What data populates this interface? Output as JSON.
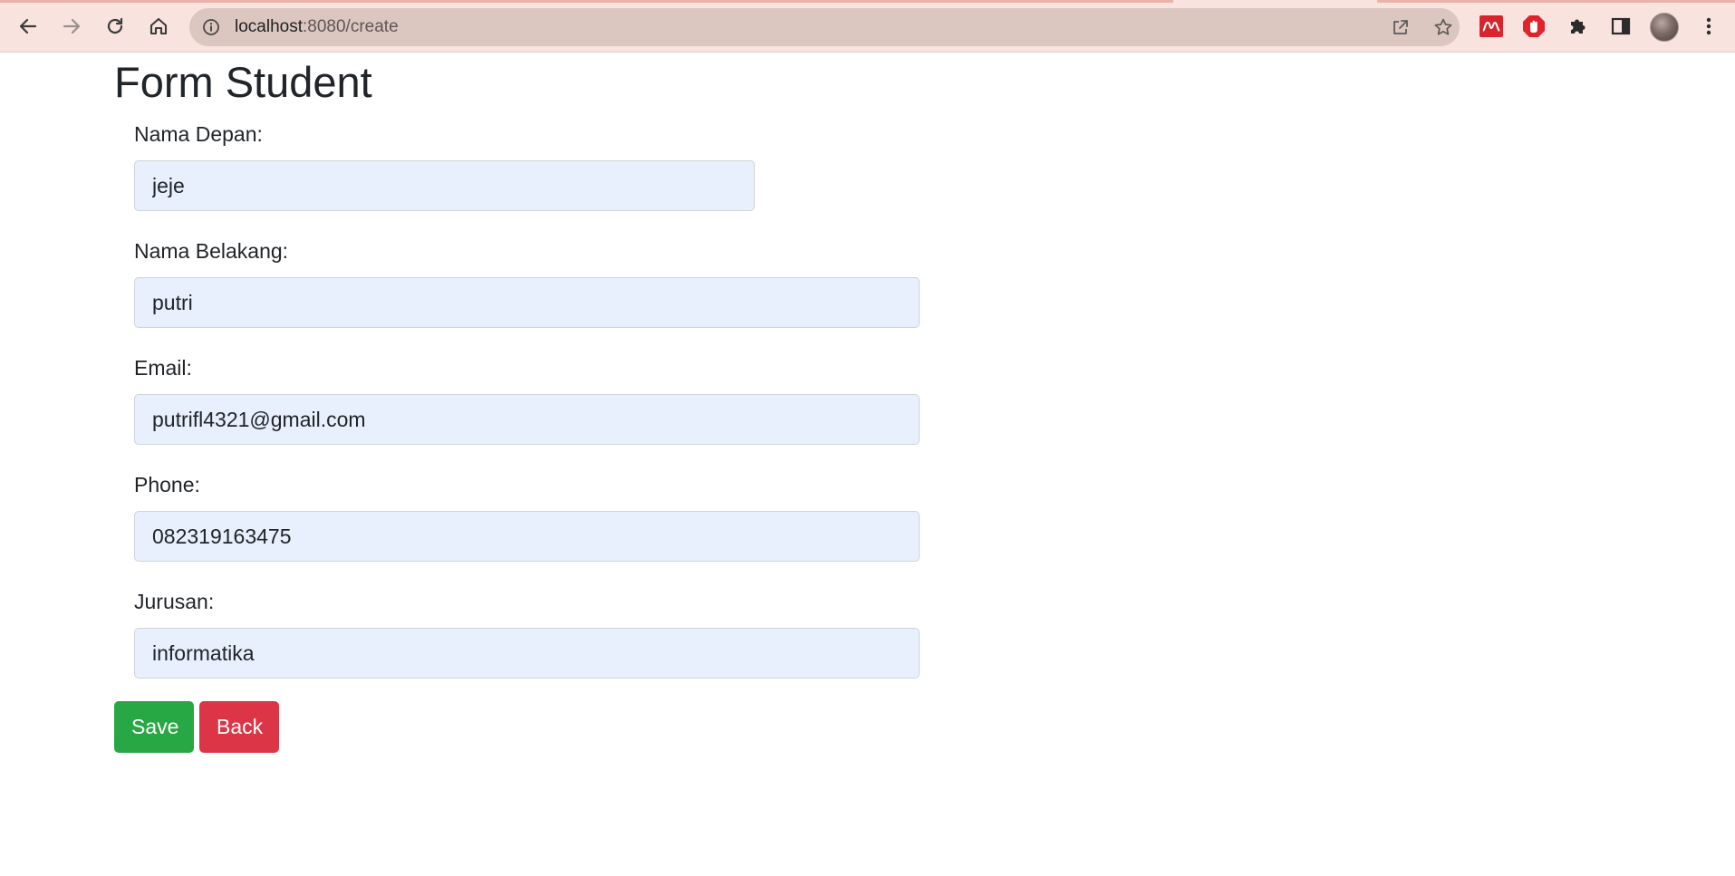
{
  "browser": {
    "url_host": "localhost",
    "url_path": ":8080/create"
  },
  "form": {
    "title": "Form Student",
    "fields": [
      {
        "label": "Nama Depan:",
        "value": "jeje"
      },
      {
        "label": "Nama Belakang:",
        "value": "putri"
      },
      {
        "label": "Email:",
        "value": "putrifl4321@gmail.com"
      },
      {
        "label": "Phone:",
        "value": "082319163475"
      },
      {
        "label": "Jurusan:",
        "value": "informatika"
      }
    ],
    "save_label": "Save",
    "back_label": "Back"
  },
  "colors": {
    "save": "#28a745",
    "back": "#dc3545",
    "input_bg": "#e8f0fe",
    "chrome_bg": "#f8e3de"
  },
  "icons": {
    "toolbar": [
      "back-arrow-icon",
      "forward-arrow-icon",
      "reload-icon",
      "home-icon",
      "info-icon",
      "share-icon",
      "star-icon",
      "mendeley-icon",
      "adblock-icon",
      "extensions-puzzle-icon",
      "side-panel-icon",
      "profile-avatar",
      "kebab-menu-icon"
    ]
  }
}
